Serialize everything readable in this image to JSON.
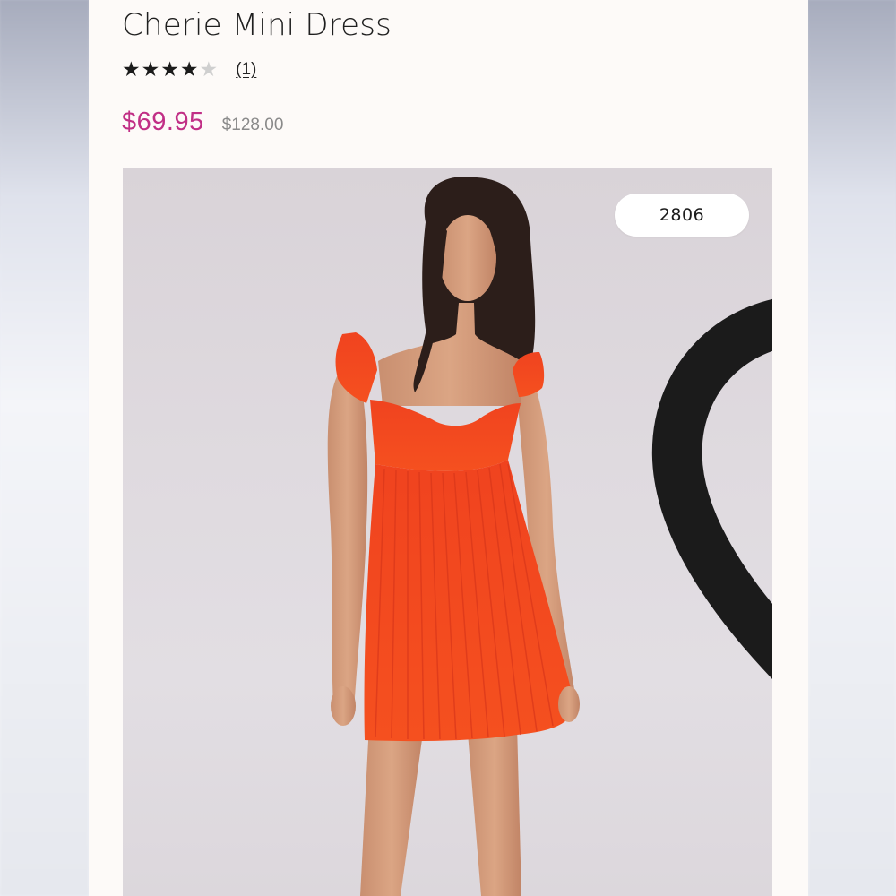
{
  "product": {
    "title": "Cherie Mini Dress",
    "rating": {
      "stars_filled": 4,
      "stars_total": 5,
      "review_count_label": "(1)"
    },
    "price": {
      "sale": "$69.95",
      "original": "$128.00"
    },
    "favorites": {
      "count": "2806",
      "icon": "heart-outline-icon"
    },
    "image": {
      "subject": "model wearing orange pleated mini dress",
      "dress_color": "#f2401f",
      "background_color": "#ddd8dd"
    }
  },
  "colors": {
    "sale_price": "#c12f86",
    "page_background": "#fdfaf8"
  }
}
